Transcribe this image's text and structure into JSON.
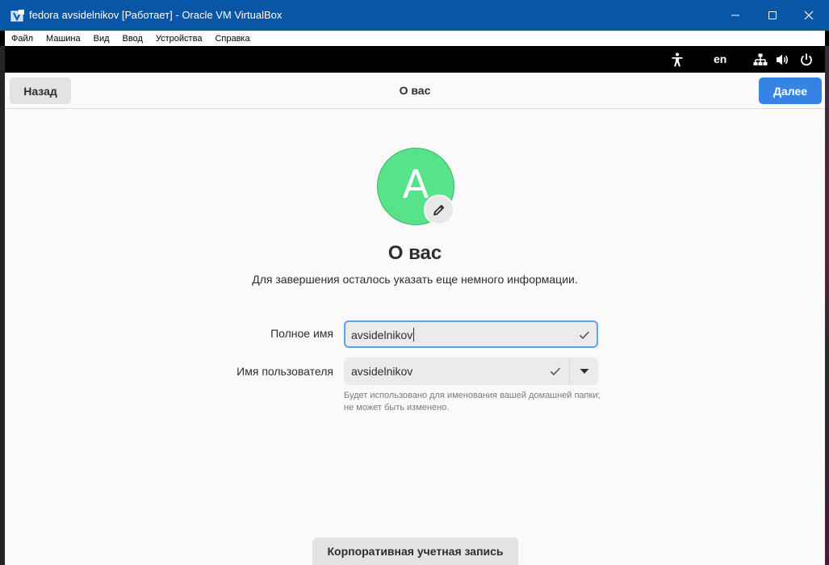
{
  "window": {
    "title": "fedora avsidelnikov [Работает] - Oracle VM VirtualBox"
  },
  "menubar": {
    "items": [
      "Файл",
      "Машина",
      "Вид",
      "Ввод",
      "Устройства",
      "Справка"
    ]
  },
  "guest_topbar": {
    "keyboard_layout": "en",
    "icons": [
      "accessibility-icon",
      "network-icon",
      "volume-icon",
      "power-icon"
    ]
  },
  "headerbar": {
    "back_label": "Назад",
    "title": "О вас",
    "next_label": "Далее"
  },
  "avatar": {
    "letter": "A",
    "color": "#57e389"
  },
  "page": {
    "heading": "О вас",
    "subtitle": "Для завершения осталось указать еще немного информации."
  },
  "form": {
    "full_name_label": "Полное имя",
    "full_name_value": "avsidelnikov",
    "username_label": "Имя пользователя",
    "username_value": "avsidelnikov",
    "username_hint": "Будет использовано для именования вашей домашней папки; не может быть изменено."
  },
  "footer": {
    "enterprise_label": "Корпоративная учетная запись"
  },
  "colors": {
    "titlebar": "#0a56a6",
    "accent": "#3584e4",
    "focus_ring": "#5ea3ef"
  }
}
